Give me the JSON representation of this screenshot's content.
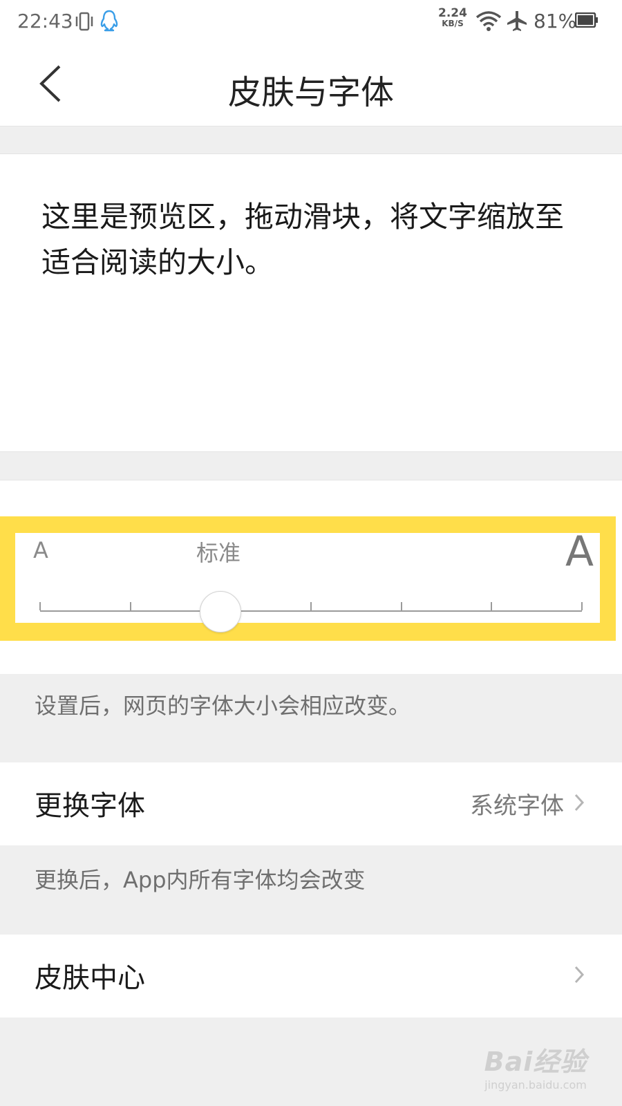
{
  "status_bar": {
    "time": "22:43",
    "net_speed_value": "2.24",
    "net_speed_unit": "KB/S",
    "battery": "81%"
  },
  "nav": {
    "title": "皮肤与字体",
    "back_icon": "chevron-left-icon"
  },
  "preview": {
    "text": "这里是预览区，拖动滑块，将文字缩放至适合阅读的大小。"
  },
  "font_size_slider": {
    "min_label": "A",
    "max_label": "A",
    "current_label": "标准",
    "steps": 7,
    "selected_step_index": 2,
    "highlight_color": "#ffde4a"
  },
  "hints": {
    "webpage_font_note": "设置后，网页的字体大小会相应改变。",
    "app_font_note": "更换后，App内所有字体均会改变"
  },
  "settings": {
    "change_font": {
      "label": "更换字体",
      "value": "系统字体"
    },
    "skin_center": {
      "label": "皮肤中心"
    }
  },
  "watermark": {
    "logo": "Bai经验",
    "url": "jingyan.baidu.com"
  }
}
